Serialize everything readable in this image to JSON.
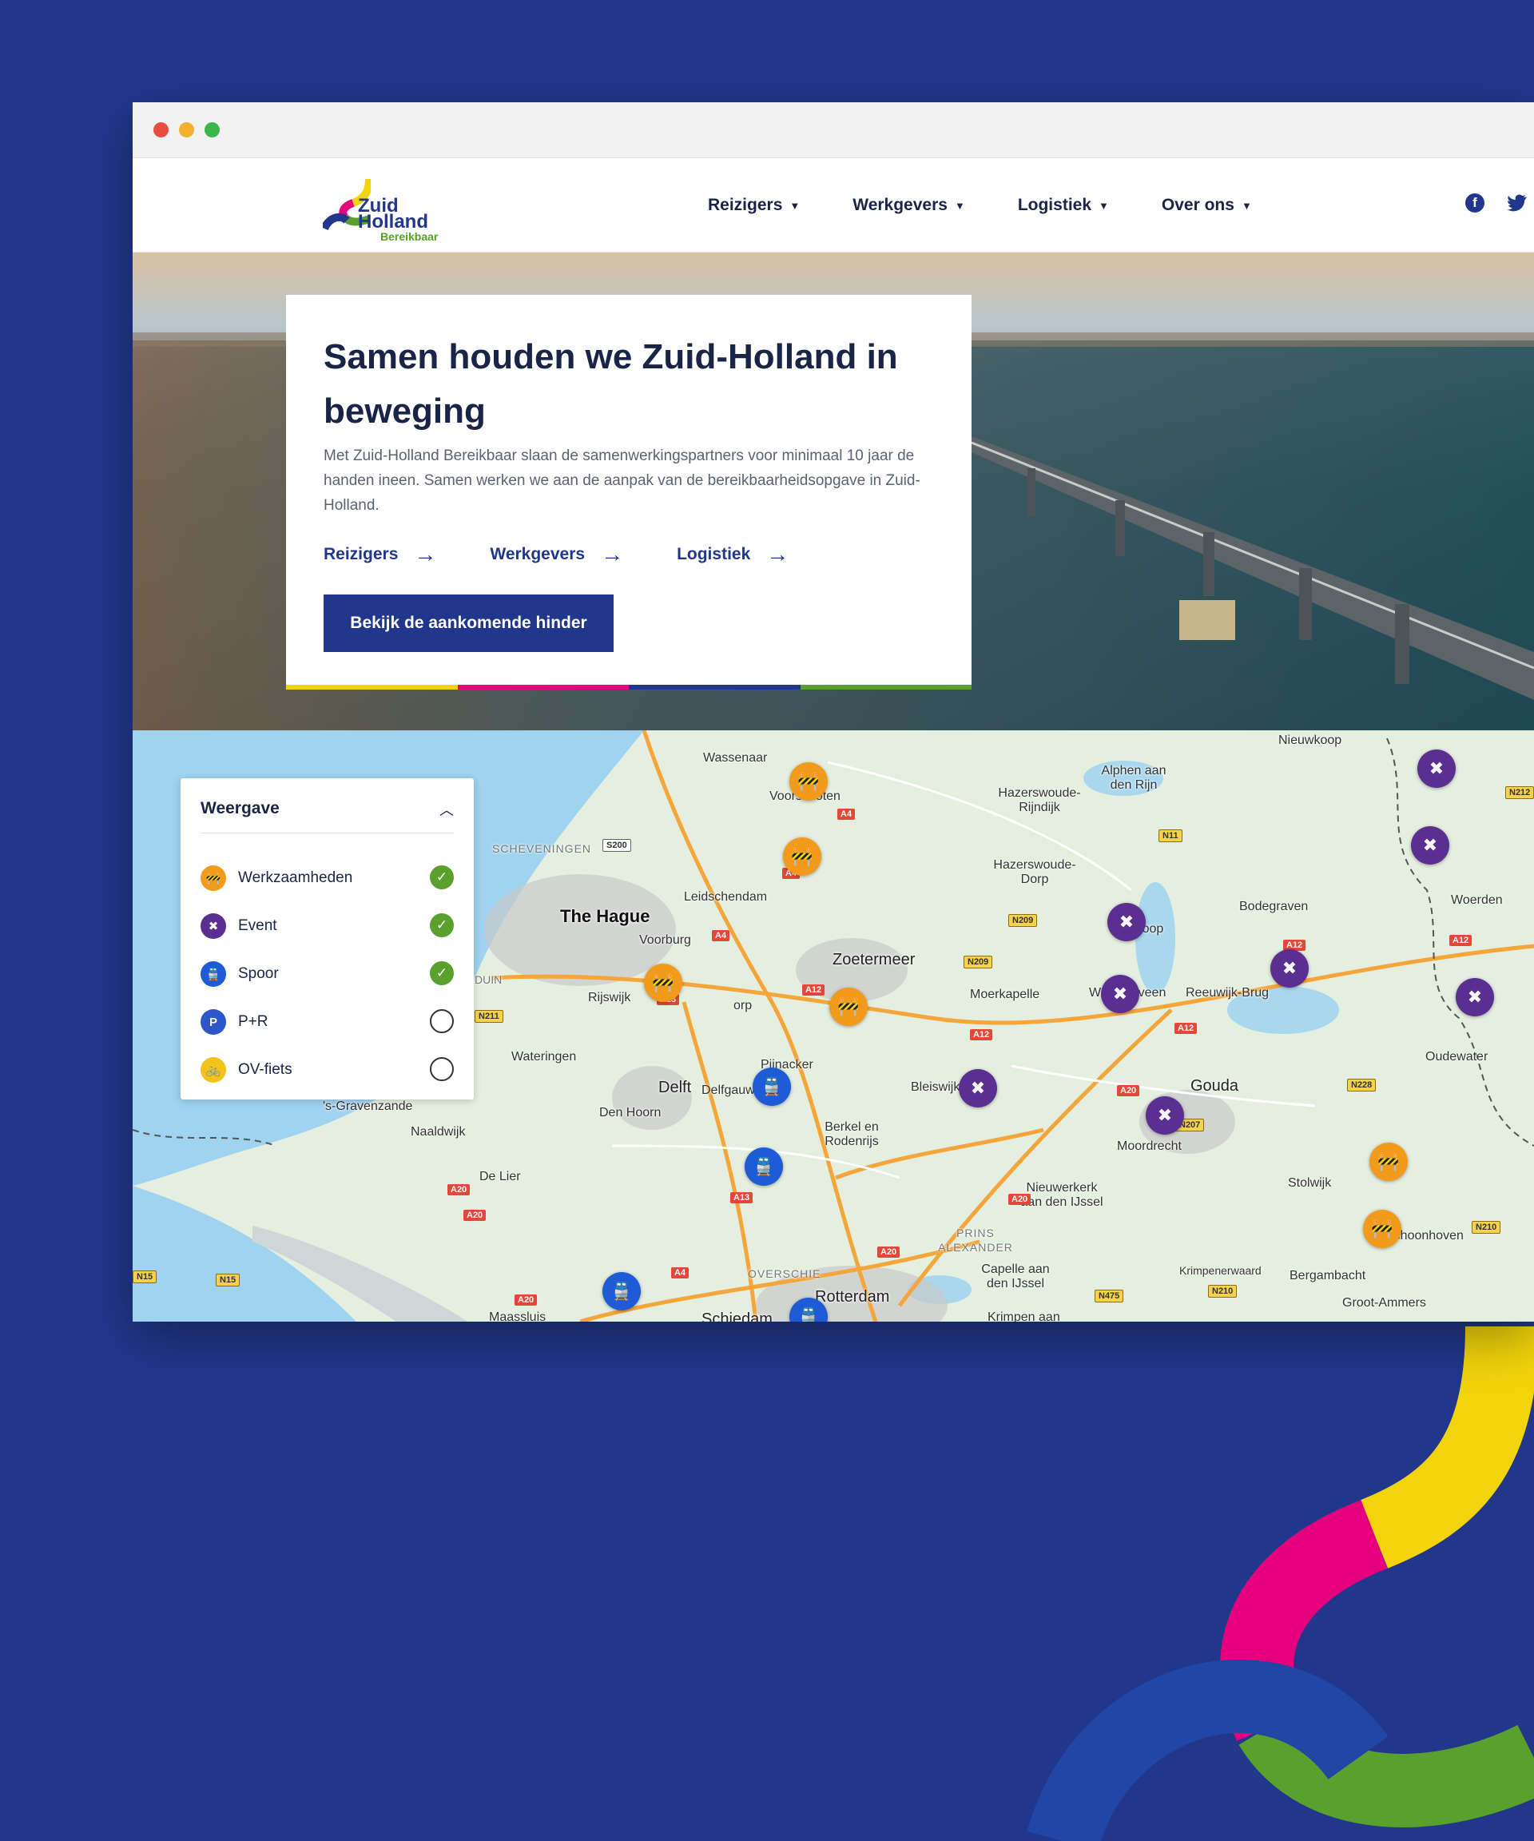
{
  "colors": {
    "background": "#21378c",
    "brand_blue": "#21378c",
    "brand_yellow": "#f1d40b",
    "brand_pink": "#e5007e",
    "brand_green": "#5aa02c",
    "brand_darkblue": "#1f3c96"
  },
  "browser": {
    "window_controls": [
      "close",
      "minimize",
      "maximize"
    ]
  },
  "header": {
    "logo": {
      "line1": "Zuid",
      "line2": "Holland",
      "line3": "Bereikbaar"
    },
    "nav": [
      {
        "label": "Reizigers"
      },
      {
        "label": "Werkgevers"
      },
      {
        "label": "Logistiek"
      },
      {
        "label": "Over ons"
      }
    ],
    "social": [
      {
        "icon": "facebook-icon"
      },
      {
        "icon": "twitter-icon"
      }
    ]
  },
  "hero": {
    "title": "Samen houden we Zuid-Holland in beweging",
    "text": "Met Zuid-Holland Bereikbaar slaan de samenwerkingspartners voor minimaal 10 jaar de handen ineen. Samen werken we aan de aanpak van de bereikbaarheidsopgave in Zuid-Holland.",
    "links": [
      {
        "label": "Reizigers"
      },
      {
        "label": "Werkgevers"
      },
      {
        "label": "Logistiek"
      }
    ],
    "button": "Bekijk de aankomende hinder"
  },
  "map": {
    "panel": {
      "title": "Weergave",
      "items": [
        {
          "label": "Werkzaamheden",
          "icon": "roadworks-icon",
          "color": "#f29a1c",
          "checked": true
        },
        {
          "label": "Event",
          "icon": "event-icon",
          "color": "#5b2e91",
          "checked": true
        },
        {
          "label": "Spoor",
          "icon": "train-icon",
          "color": "#1e5bd6",
          "checked": true
        },
        {
          "label": "P+R",
          "icon": "parking-icon",
          "color": "#2d56c8",
          "checked": false
        },
        {
          "label": "OV-fiets",
          "icon": "bicycle-icon",
          "color": "#f2c31c",
          "checked": false
        }
      ]
    },
    "places": [
      "Wassenaar",
      "Voorschoten",
      "Hazerswoude-Rijndijk",
      "Alphen aan den Rijn",
      "Nieuwkoop",
      "SCHEVENINGEN",
      "The Hague",
      "Leidschendam",
      "Hazerswoude-Dorp",
      "Bodegraven",
      "Woerden",
      "Voorburg",
      "Zoetermeer",
      "Boskoop",
      "Rijswijk",
      "Moerkapelle",
      "Waddinxveen",
      "Reeuwijk-Brug",
      "Wateringen",
      "Pijnacker",
      "Bleiswijk",
      "Oudewater",
      "Delft",
      "Delfgauw",
      "Gouda",
      "Den Hoorn",
      "'s-Gravenzande",
      "Naaldwijk",
      "Berkel en Rodenrijs",
      "Moordrecht",
      "De Lier",
      "Stolwijk",
      "Nieuwerkerk aan den IJssel",
      "Schoonhoven",
      "PRINS ALEXANDER",
      "Capelle aan den IJssel",
      "OVERSCHIE",
      "Rotterdam",
      "Krimpenerwaard",
      "Bergambacht",
      "Groot-Ammers",
      "Maassluis",
      "Schiedam",
      "Krimpen aan",
      "DUIN",
      "orp"
    ],
    "roads": [
      "A4",
      "S200",
      "A4",
      "N11",
      "A4",
      "N209",
      "N209",
      "A12",
      "A12",
      "A13",
      "A12",
      "N211",
      "A12",
      "A20",
      "N207",
      "N228",
      "A13",
      "A20",
      "A20",
      "A20",
      "A20",
      "N475",
      "N210",
      "N210",
      "A20",
      "N15",
      "N15",
      "A4",
      "N212",
      "A12"
    ]
  }
}
